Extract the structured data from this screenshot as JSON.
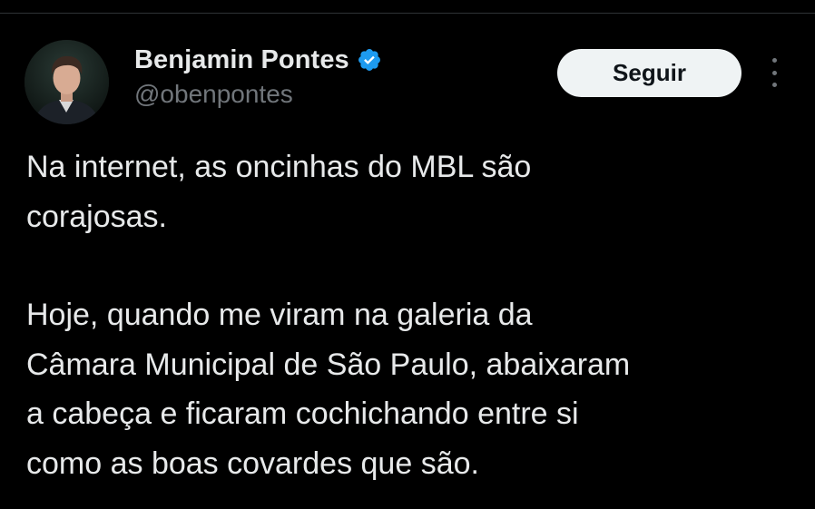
{
  "author": {
    "display_name": "Benjamin Pontes",
    "handle": "@obenpontes",
    "verified": true,
    "verified_color": "#1d9bf0",
    "avatar_icon": "profile-photo"
  },
  "actions": {
    "follow_label": "Seguir",
    "more_icon": "more-options-icon"
  },
  "tweet": {
    "paragraphs": [
      {
        "lines": [
          "Na internet, as oncinhas do MBL são",
          "corajosas."
        ]
      },
      {
        "lines": [
          "Hoje, quando me viram na galeria da",
          "Câmara Municipal de São Paulo, abaixaram",
          "a cabeça e ficaram cochichando entre si",
          "como as boas covardes que são."
        ]
      }
    ]
  },
  "colors": {
    "background": "#000000",
    "text_primary": "#e7e9ea",
    "text_secondary": "#71767b",
    "button_bg": "#eff3f4",
    "button_text": "#0f1419"
  }
}
